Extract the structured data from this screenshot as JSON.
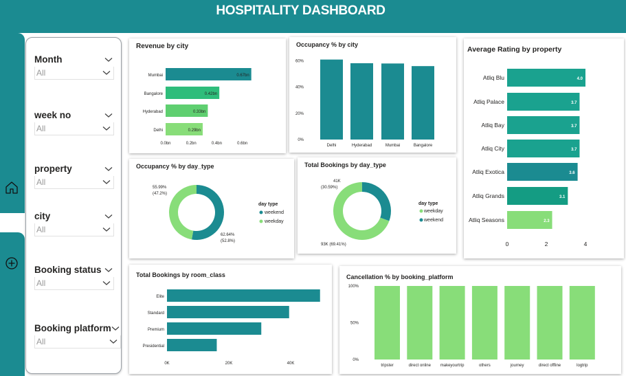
{
  "header": {
    "title": "HOSPITALITY DASHBOARD"
  },
  "colors": {
    "teal": "#1b8b91",
    "green_dark": "#2ebd7b",
    "green_light": "#88dd79",
    "rating_teal": "#1aa28f"
  },
  "rail": {
    "icons": [
      "home-icon",
      "add-circle-icon"
    ]
  },
  "slicers": [
    {
      "label": "Month",
      "value": "All"
    },
    {
      "label": "week no",
      "value": "All"
    },
    {
      "label": "property",
      "value": "All"
    },
    {
      "label": "city",
      "value": "All"
    },
    {
      "label": "Booking status",
      "value": "All"
    },
    {
      "label": "Booking platform",
      "value": "All"
    }
  ],
  "chart_data": [
    {
      "id": "revenue_by_city",
      "type": "bar",
      "orientation": "horizontal",
      "title": "Revenue by city",
      "categories": [
        "Mumbai",
        "Bangalore",
        "Hyderabad",
        "Delhi"
      ],
      "values": [
        0.67,
        0.42,
        0.33,
        0.29
      ],
      "data_labels": [
        "0.67bn",
        "0.42bn",
        "0.33bn",
        "0.29bn"
      ],
      "bar_colors": [
        "#1b8b91",
        "#2ebd7b",
        "#5fcf70",
        "#88dd79"
      ],
      "xticks": [
        "0.0bn",
        "0.2bn",
        "0.4bn",
        "0.6bn"
      ],
      "xlim": [
        0,
        0.72
      ]
    },
    {
      "id": "occupancy_by_city",
      "type": "bar",
      "title": "Occupancy % by city",
      "categories": [
        "Delhi",
        "Hyderabad",
        "Mumbai",
        "Bangalore"
      ],
      "values": [
        61,
        58.2,
        58,
        56
      ],
      "yticks": [
        "0%",
        "20%",
        "40%",
        "60%"
      ],
      "ylim": [
        0,
        65
      ]
    },
    {
      "id": "avg_rating_by_property",
      "type": "bar",
      "orientation": "horizontal",
      "title": "Average Rating by property",
      "categories": [
        "Atliq Blu",
        "Atliq Palace",
        "Atliq Bay",
        "Atliq City",
        "Atliq Exotica",
        "Atliq Grands",
        "Atliq Seasons"
      ],
      "values": [
        4.0,
        3.7,
        3.7,
        3.7,
        3.6,
        3.1,
        2.3
      ],
      "data_labels": [
        "4.0",
        "3.7",
        "3.7",
        "3.7",
        "3.6",
        "3.1",
        "2.3"
      ],
      "bar_colors": [
        "#1aa28f",
        "#1aa28f",
        "#1aa28f",
        "#1aa28f",
        "#1b8b91",
        "#149c83",
        "#88dd79"
      ],
      "xticks": [
        "0",
        "2",
        "4"
      ],
      "xlim": [
        0,
        4
      ]
    },
    {
      "id": "occupancy_by_day_type",
      "type": "pie",
      "donut": true,
      "title": "Occupancy % by day_type",
      "legend_title": "day type",
      "slices": [
        {
          "name": "weekend",
          "value": 62.64,
          "label_value": "62.64%",
          "label_pct": "(52.8%)",
          "color": "#1b8b91"
        },
        {
          "name": "weekday",
          "value": 55.99,
          "label_value": "55.99%",
          "label_pct": "(47.2%)",
          "color": "#88dd79"
        }
      ]
    },
    {
      "id": "bookings_by_day_type",
      "type": "pie",
      "donut": true,
      "title": "Total Bookings by day_type",
      "legend_title": "day type",
      "slices": [
        {
          "name": "weekday",
          "value": 93,
          "label_value": "93K",
          "label_pct": "(69.41%)",
          "color": "#88dd79"
        },
        {
          "name": "weekend",
          "value": 41,
          "label_value": "41K",
          "label_pct": "(30.59%)",
          "color": "#1b8b91"
        }
      ]
    },
    {
      "id": "bookings_by_room_class",
      "type": "bar",
      "orientation": "horizontal",
      "title": "Total Bookings by room_class",
      "categories": [
        "Elite",
        "Standard",
        "Premium",
        "Presidential"
      ],
      "values": [
        49.5,
        39.5,
        30.5,
        16.1
      ],
      "xticks": [
        "0K",
        "20K",
        "40K"
      ],
      "xlim": [
        0,
        50
      ]
    },
    {
      "id": "cancellation_by_platform",
      "type": "bar",
      "title": "Cancellation % by booking_platform",
      "categories": [
        "tripster",
        "direct online",
        "makeyourtrip",
        "others",
        "journey",
        "direct offline",
        "logtrip"
      ],
      "values": [
        100,
        100,
        100,
        100,
        100,
        100,
        100
      ],
      "yticks": [
        "0%",
        "50%",
        "100%"
      ],
      "ylim": [
        0,
        100
      ]
    }
  ]
}
